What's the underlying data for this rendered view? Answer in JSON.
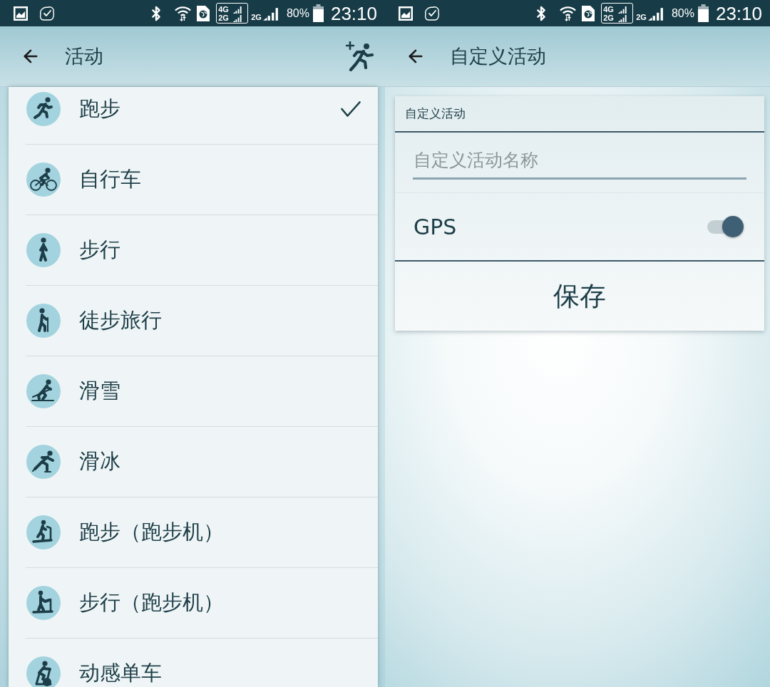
{
  "activity_list_screen": {
    "status_bar": {
      "sim1_labels": [
        "4G",
        "2G"
      ],
      "sim2_label": "2G",
      "battery": "80%",
      "time": "23:10"
    },
    "app_bar": {
      "title": "活动"
    },
    "activities": [
      {
        "label": "跑步",
        "selected": true
      },
      {
        "label": "自行车",
        "selected": false
      },
      {
        "label": "步行",
        "selected": false
      },
      {
        "label": "徒步旅行",
        "selected": false
      },
      {
        "label": "滑雪",
        "selected": false
      },
      {
        "label": "滑冰",
        "selected": false
      },
      {
        "label": "跑步（跑步机）",
        "selected": false
      },
      {
        "label": "步行（跑步机）",
        "selected": false
      },
      {
        "label": "动感单车",
        "selected": false
      }
    ]
  },
  "custom_activity_screen": {
    "status_bar": {
      "sim1_labels": [
        "4G",
        "2G"
      ],
      "sim2_label": "2G",
      "battery": "80%",
      "time": "23:10"
    },
    "app_bar": {
      "title": "自定义活动"
    },
    "card": {
      "title": "自定义活动",
      "name_field": {
        "placeholder": "自定义活动名称"
      },
      "gps": {
        "label": "GPS",
        "on": true
      },
      "save_button": "保存"
    }
  }
}
